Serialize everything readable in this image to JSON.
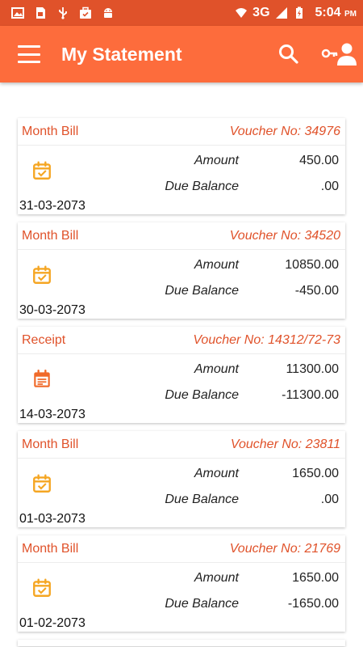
{
  "status_bar": {
    "network": "3G",
    "time": "5:04",
    "ampm": "PM"
  },
  "app_bar": {
    "title": "My Statement"
  },
  "labels": {
    "amount": "Amount",
    "due_balance": "Due Balance"
  },
  "entries": [
    {
      "type": "Month Bill",
      "voucher": "Voucher No: 34976",
      "amount": "450.00",
      "due_balance": ".00",
      "date": "31-03-2073",
      "icon": "calendar-check-icon"
    },
    {
      "type": "Month Bill",
      "voucher": "Voucher No: 34520",
      "amount": "10850.00",
      "due_balance": "-450.00",
      "date": "30-03-2073",
      "icon": "calendar-check-icon"
    },
    {
      "type": "Receipt",
      "voucher": "Voucher No: 14312/72-73",
      "amount": "11300.00",
      "due_balance": "-11300.00",
      "date": "14-03-2073",
      "icon": "receipt-icon"
    },
    {
      "type": "Month Bill",
      "voucher": "Voucher No: 23811",
      "amount": "1650.00",
      "due_balance": ".00",
      "date": "01-03-2073",
      "icon": "calendar-check-icon"
    },
    {
      "type": "Month Bill",
      "voucher": "Voucher No: 21769",
      "amount": "1650.00",
      "due_balance": "-1650.00",
      "date": "01-02-2073",
      "icon": "calendar-check-icon"
    }
  ],
  "colors": {
    "status_bar": "#e0522a",
    "app_bar": "#fd6c3c",
    "accent_text": "#e0522a",
    "bill_icon": "#f5a623",
    "receipt_icon": "#f06a2a"
  }
}
